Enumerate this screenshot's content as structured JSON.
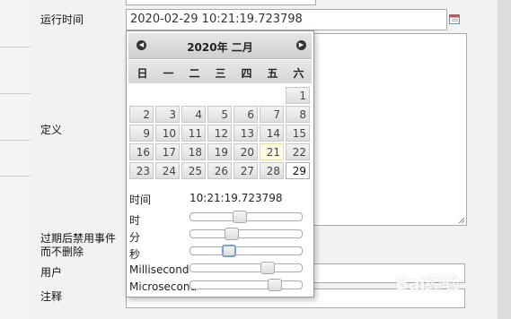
{
  "form": {
    "run_time_label": "运行时间",
    "run_time_value": "2020-02-29 10:21:19.723798",
    "definition_label": "定义",
    "disable_label_line1": "过期后禁用事件",
    "disable_label_line2": "而不删除",
    "user_label": "用户",
    "note_label": "注释"
  },
  "datepicker": {
    "title": "2020年 二月",
    "prev_icon": "◀",
    "next_icon": "▶",
    "weekdays": [
      "日",
      "一",
      "二",
      "三",
      "四",
      "五",
      "六"
    ],
    "days": [
      "1",
      "2",
      "3",
      "4",
      "5",
      "6",
      "7",
      "8",
      "9",
      "10",
      "11",
      "12",
      "13",
      "14",
      "15",
      "16",
      "17",
      "18",
      "19",
      "20",
      "21",
      "22",
      "23",
      "24",
      "25",
      "26",
      "27",
      "28",
      "29"
    ],
    "today": "21",
    "selected": "29",
    "time_label": "时间",
    "time_value": "10:21:19.723798",
    "sliders": [
      {
        "label": "时",
        "value": 10,
        "max": 23
      },
      {
        "label": "分",
        "value": 21,
        "max": 59
      },
      {
        "label": "秒",
        "value": 19,
        "max": 59
      },
      {
        "label": "Millisecond",
        "value": 723,
        "max": 999
      },
      {
        "label": "Microsecond",
        "value": 798,
        "max": 999
      }
    ]
  },
  "icons": {
    "calendar": "calendar-icon"
  },
  "watermark": "Bai经验"
}
